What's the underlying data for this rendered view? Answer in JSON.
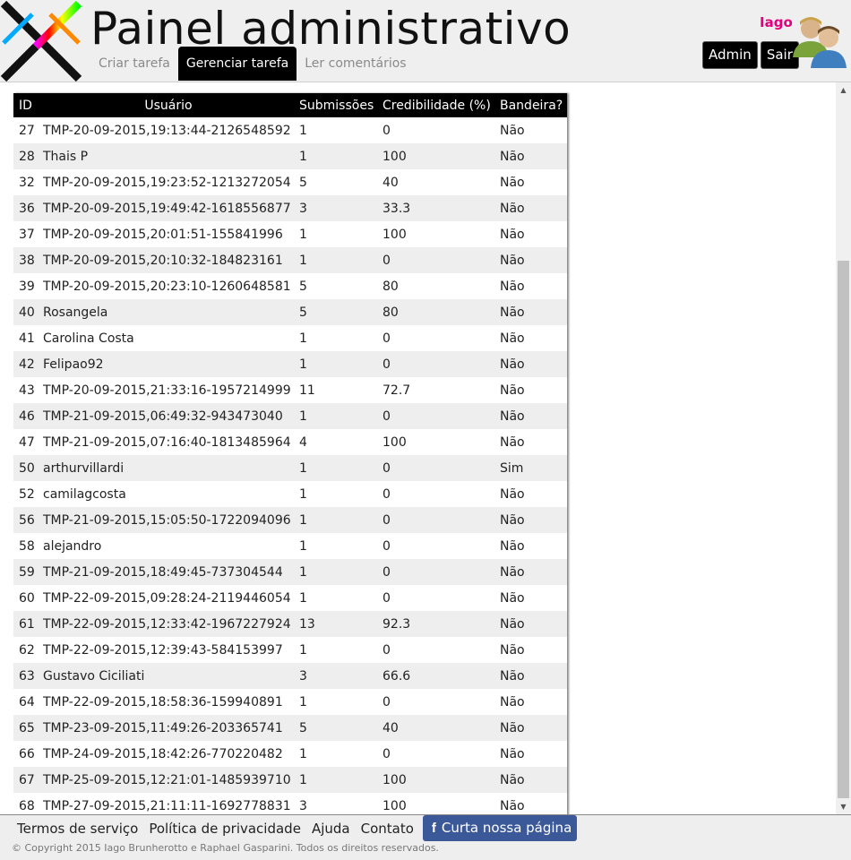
{
  "header": {
    "logo_icon": "colorful-x-logo-icon",
    "title": "Painel administrativo",
    "tabs": [
      {
        "label": "Criar tarefa",
        "active": false
      },
      {
        "label": "Gerenciar tarefa",
        "active": true
      },
      {
        "label": "Ler comentários",
        "active": false
      }
    ],
    "username": "Iago",
    "admin_label": "Admin",
    "logout_label": "Sair",
    "avatar_icon": "users-icon"
  },
  "table": {
    "columns": [
      "ID",
      "Usuário",
      "Submissões",
      "Credibilidade (%)",
      "Bandeira?"
    ],
    "rows": [
      [
        "27",
        "TMP-20-09-2015,19:13:44-2126548592",
        "1",
        "0",
        "Não"
      ],
      [
        "28",
        "Thais P",
        "1",
        "100",
        "Não"
      ],
      [
        "32",
        "TMP-20-09-2015,19:23:52-1213272054",
        "5",
        "40",
        "Não"
      ],
      [
        "36",
        "TMP-20-09-2015,19:49:42-1618556877",
        "3",
        "33.3",
        "Não"
      ],
      [
        "37",
        "TMP-20-09-2015,20:01:51-155841996",
        "1",
        "100",
        "Não"
      ],
      [
        "38",
        "TMP-20-09-2015,20:10:32-184823161",
        "1",
        "0",
        "Não"
      ],
      [
        "39",
        "TMP-20-09-2015,20:23:10-1260648581",
        "5",
        "80",
        "Não"
      ],
      [
        "40",
        "Rosangela",
        "5",
        "80",
        "Não"
      ],
      [
        "41",
        "Carolina Costa",
        "1",
        "0",
        "Não"
      ],
      [
        "42",
        "Felipao92",
        "1",
        "0",
        "Não"
      ],
      [
        "43",
        "TMP-20-09-2015,21:33:16-1957214999",
        "11",
        "72.7",
        "Não"
      ],
      [
        "46",
        "TMP-21-09-2015,06:49:32-943473040",
        "1",
        "0",
        "Não"
      ],
      [
        "47",
        "TMP-21-09-2015,07:16:40-1813485964",
        "4",
        "100",
        "Não"
      ],
      [
        "50",
        "arthurvillardi",
        "1",
        "0",
        "Sim"
      ],
      [
        "52",
        "camilagcosta",
        "1",
        "0",
        "Não"
      ],
      [
        "56",
        "TMP-21-09-2015,15:05:50-1722094096",
        "1",
        "0",
        "Não"
      ],
      [
        "58",
        "alejandro",
        "1",
        "0",
        "Não"
      ],
      [
        "59",
        "TMP-21-09-2015,18:49:45-737304544",
        "1",
        "0",
        "Não"
      ],
      [
        "60",
        "TMP-22-09-2015,09:28:24-2119446054",
        "1",
        "0",
        "Não"
      ],
      [
        "61",
        "TMP-22-09-2015,12:33:42-1967227924",
        "13",
        "92.3",
        "Não"
      ],
      [
        "62",
        "TMP-22-09-2015,12:39:43-584153997",
        "1",
        "0",
        "Não"
      ],
      [
        "63",
        "Gustavo Ciciliati",
        "3",
        "66.6",
        "Não"
      ],
      [
        "64",
        "TMP-22-09-2015,18:58:36-159940891",
        "1",
        "0",
        "Não"
      ],
      [
        "65",
        "TMP-23-09-2015,11:49:26-203365741",
        "5",
        "40",
        "Não"
      ],
      [
        "66",
        "TMP-24-09-2015,18:42:26-770220482",
        "1",
        "0",
        "Não"
      ],
      [
        "67",
        "TMP-25-09-2015,12:21:01-1485939710",
        "1",
        "100",
        "Não"
      ],
      [
        "68",
        "TMP-27-09-2015,21:11:11-1692778831",
        "3",
        "100",
        "Não"
      ]
    ]
  },
  "footer": {
    "links": [
      "Termos de serviço",
      "Política de privacidade",
      "Ajuda",
      "Contato"
    ],
    "facebook_icon": "facebook-icon",
    "facebook_glyph": "f",
    "facebook_label": "Curta nossa página",
    "copyright": "© Copyright 2015 Iago Brunherotto e Raphael Gasparini. Todos os direitos reservados."
  },
  "colors": {
    "username": "#e4007c",
    "active_tab": "#000000",
    "facebook": "#3b5998"
  }
}
